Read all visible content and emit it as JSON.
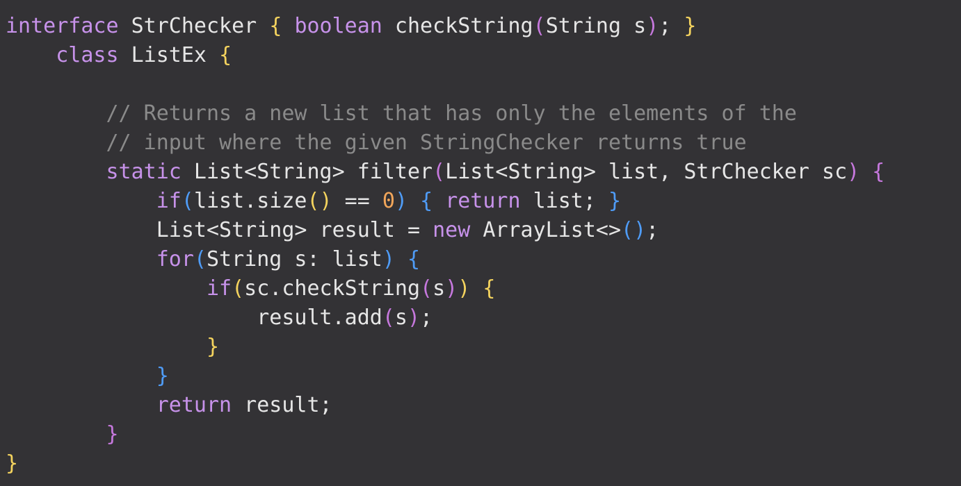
{
  "colors": {
    "background": "#333235",
    "text": "#e6e6e6",
    "keyword": "#c792ea",
    "comment": "#8a8a8a",
    "number": "#f2a65a",
    "bracket_yellow": "#f4d35e",
    "bracket_purple": "#c678dd",
    "bracket_blue": "#4f9cf7"
  },
  "code": {
    "lines": [
      [
        {
          "t": "interface",
          "c": "kw"
        },
        {
          "t": " StrChecker ",
          "c": "plain"
        },
        {
          "t": "{",
          "c": "br-y"
        },
        {
          "t": " ",
          "c": "plain"
        },
        {
          "t": "boolean",
          "c": "kw"
        },
        {
          "t": " checkString",
          "c": "plain"
        },
        {
          "t": "(",
          "c": "br-p"
        },
        {
          "t": "String s",
          "c": "plain"
        },
        {
          "t": ")",
          "c": "br-p"
        },
        {
          "t": "; ",
          "c": "plain"
        },
        {
          "t": "}",
          "c": "br-y"
        }
      ],
      [
        {
          "t": "    ",
          "c": "plain"
        },
        {
          "t": "class",
          "c": "kw"
        },
        {
          "t": " ListEx ",
          "c": "plain"
        },
        {
          "t": "{",
          "c": "br-y"
        }
      ],
      [
        {
          "t": "",
          "c": "plain"
        }
      ],
      [
        {
          "t": "        // Returns a new list that has only the elements of the",
          "c": "cm"
        }
      ],
      [
        {
          "t": "        // input where the given StringChecker returns true",
          "c": "cm"
        }
      ],
      [
        {
          "t": "        ",
          "c": "plain"
        },
        {
          "t": "static",
          "c": "kw"
        },
        {
          "t": " List<String> filter",
          "c": "plain"
        },
        {
          "t": "(",
          "c": "br-p"
        },
        {
          "t": "List<String> list, StrChecker sc",
          "c": "plain"
        },
        {
          "t": ")",
          "c": "br-p"
        },
        {
          "t": " ",
          "c": "plain"
        },
        {
          "t": "{",
          "c": "br-p"
        }
      ],
      [
        {
          "t": "            ",
          "c": "plain"
        },
        {
          "t": "if",
          "c": "kw"
        },
        {
          "t": "(",
          "c": "br-b"
        },
        {
          "t": "list.size",
          "c": "plain"
        },
        {
          "t": "()",
          "c": "br-y"
        },
        {
          "t": " == ",
          "c": "plain"
        },
        {
          "t": "0",
          "c": "num"
        },
        {
          "t": ")",
          "c": "br-b"
        },
        {
          "t": " ",
          "c": "plain"
        },
        {
          "t": "{",
          "c": "br-b"
        },
        {
          "t": " ",
          "c": "plain"
        },
        {
          "t": "return",
          "c": "kw"
        },
        {
          "t": " list; ",
          "c": "plain"
        },
        {
          "t": "}",
          "c": "br-b"
        }
      ],
      [
        {
          "t": "            List<String> result = ",
          "c": "plain"
        },
        {
          "t": "new",
          "c": "kw"
        },
        {
          "t": " ArrayList<>",
          "c": "plain"
        },
        {
          "t": "()",
          "c": "br-b"
        },
        {
          "t": ";",
          "c": "plain"
        }
      ],
      [
        {
          "t": "            ",
          "c": "plain"
        },
        {
          "t": "for",
          "c": "kw"
        },
        {
          "t": "(",
          "c": "br-b"
        },
        {
          "t": "String s: list",
          "c": "plain"
        },
        {
          "t": ")",
          "c": "br-b"
        },
        {
          "t": " ",
          "c": "plain"
        },
        {
          "t": "{",
          "c": "br-b"
        }
      ],
      [
        {
          "t": "                ",
          "c": "plain"
        },
        {
          "t": "if",
          "c": "kw"
        },
        {
          "t": "(",
          "c": "br-y"
        },
        {
          "t": "sc.checkString",
          "c": "plain"
        },
        {
          "t": "(",
          "c": "br-p"
        },
        {
          "t": "s",
          "c": "plain"
        },
        {
          "t": ")",
          "c": "br-p"
        },
        {
          "t": ")",
          "c": "br-y"
        },
        {
          "t": " ",
          "c": "plain"
        },
        {
          "t": "{",
          "c": "br-y"
        }
      ],
      [
        {
          "t": "                    result.add",
          "c": "plain"
        },
        {
          "t": "(",
          "c": "br-p"
        },
        {
          "t": "s",
          "c": "plain"
        },
        {
          "t": ")",
          "c": "br-p"
        },
        {
          "t": ";",
          "c": "plain"
        }
      ],
      [
        {
          "t": "                ",
          "c": "plain"
        },
        {
          "t": "}",
          "c": "br-y"
        }
      ],
      [
        {
          "t": "            ",
          "c": "plain"
        },
        {
          "t": "}",
          "c": "br-b"
        }
      ],
      [
        {
          "t": "            ",
          "c": "plain"
        },
        {
          "t": "return",
          "c": "kw"
        },
        {
          "t": " result;",
          "c": "plain"
        }
      ],
      [
        {
          "t": "        ",
          "c": "plain"
        },
        {
          "t": "}",
          "c": "br-p"
        }
      ],
      [
        {
          "t": "}",
          "c": "br-y"
        }
      ]
    ]
  }
}
